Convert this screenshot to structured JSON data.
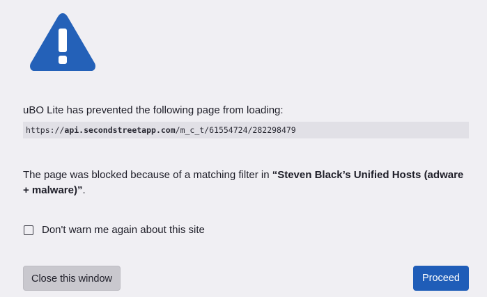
{
  "icon": "warning-triangle-icon",
  "colors": {
    "accent": "#2461b8",
    "background": "#f0eff3"
  },
  "intro_text": "uBO Lite has prevented the following page from loading:",
  "blocked_url": {
    "prefix": "https://",
    "host": "api.secondstreetapp.com",
    "path": "/m_c_t/61554724/282298479"
  },
  "reason": {
    "before": "The page was blocked because of a matching filter in ",
    "filter_name": "“Steven Black’s Unified Hosts (adware + malware)”",
    "after": "."
  },
  "dont_warn": {
    "label": "Don't warn me again about this site",
    "checked": false
  },
  "buttons": {
    "close_label": "Close this window",
    "proceed_label": "Proceed"
  }
}
